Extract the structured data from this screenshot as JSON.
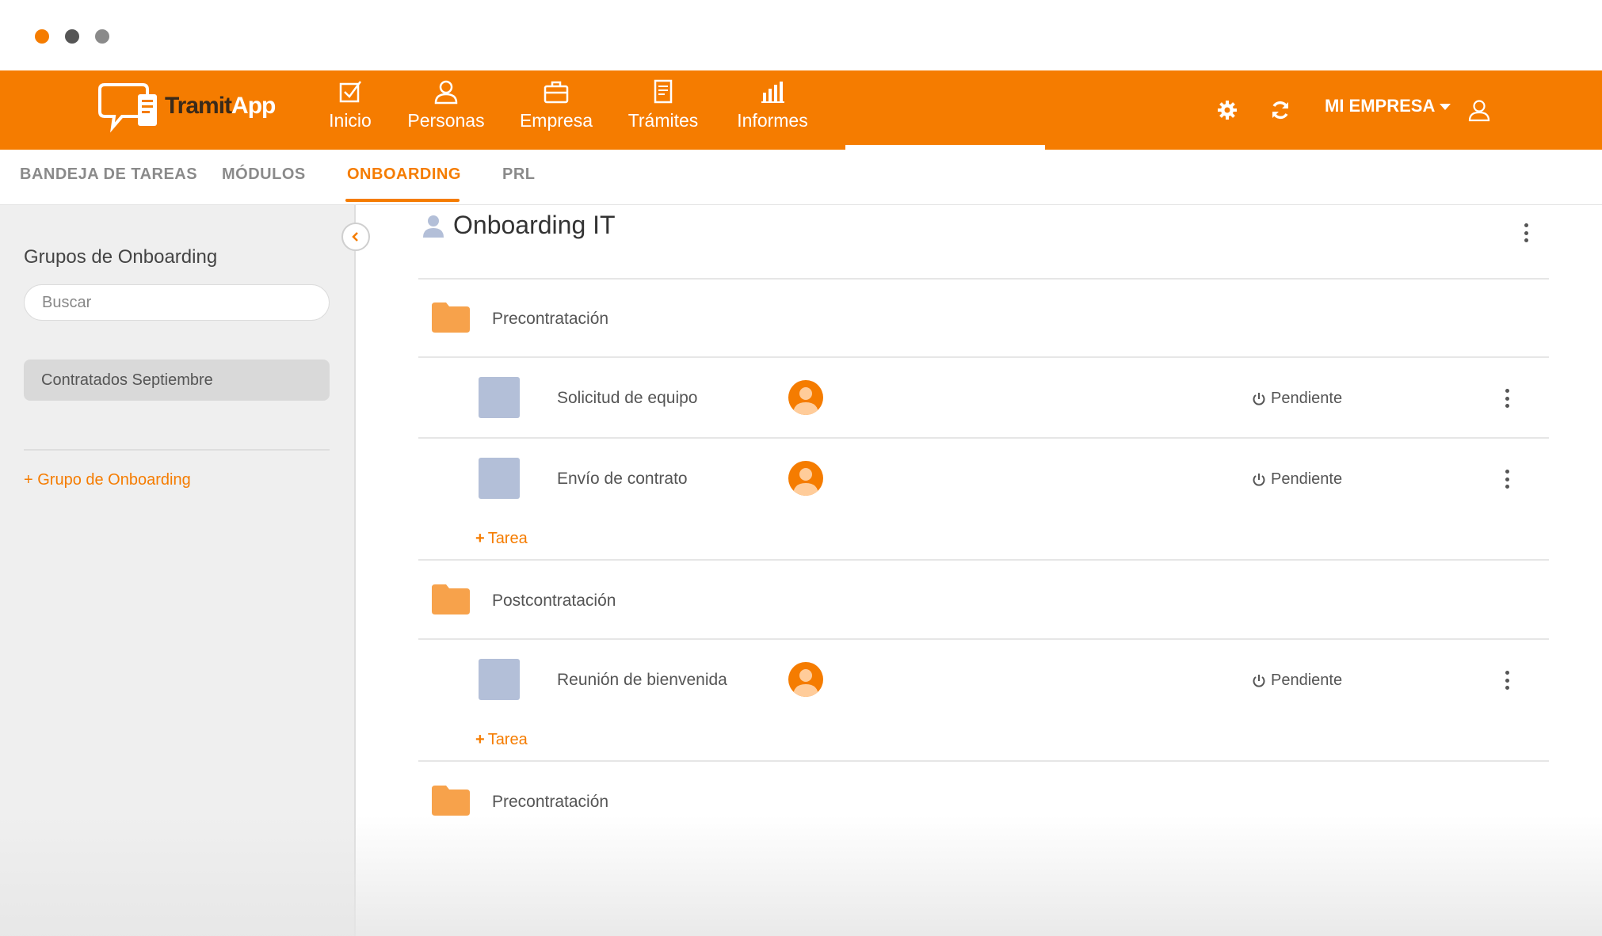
{
  "window": {
    "dot_colors": [
      "#f57c00",
      "#555555",
      "#8a8a8a"
    ]
  },
  "colors": {
    "accent": "#f57c00",
    "header_bg": "#f57c00",
    "task_check": "#b3bfd8",
    "sidebar_bg": "#efefef"
  },
  "header": {
    "logo_text_a": "Tramit",
    "logo_text_b": "App",
    "nav": [
      {
        "label": "Inicio",
        "icon": "checkbox-icon"
      },
      {
        "label": "Personas",
        "icon": "person-icon"
      },
      {
        "label": "Empresa",
        "icon": "briefcase-icon"
      },
      {
        "label": "Trámites",
        "icon": "document-icon"
      },
      {
        "label": "Informes",
        "icon": "bar-chart-icon"
      }
    ],
    "company": "MI EMPRESA",
    "icons": [
      "gear-icon",
      "refresh-icon",
      "user-icon"
    ]
  },
  "tabs": [
    {
      "label": "BANDEJA DE TAREAS",
      "active": false
    },
    {
      "label": "MÓDULOS",
      "active": false
    },
    {
      "label": "ONBOARDING",
      "active": true
    },
    {
      "label": "PRL",
      "active": false
    }
  ],
  "sidebar": {
    "title": "Grupos de Onboarding",
    "search_placeholder": "Buscar",
    "groups": [
      "Contratados Septiembre"
    ],
    "add_label": "+ Grupo de Onboarding"
  },
  "main": {
    "title": "Onboarding IT",
    "sections": [
      {
        "label": "Precontratación",
        "tasks": [
          {
            "label": "Solicitud de equipo",
            "status": "Pendiente"
          },
          {
            "label": "Envío de contrato",
            "status": "Pendiente"
          }
        ],
        "add_task": "Tarea"
      },
      {
        "label": "Postcontratación",
        "tasks": [
          {
            "label": "Reunión de bienvenida",
            "status": "Pendiente"
          }
        ],
        "add_task": "Tarea"
      },
      {
        "label": "Precontratación",
        "tasks": []
      }
    ]
  }
}
